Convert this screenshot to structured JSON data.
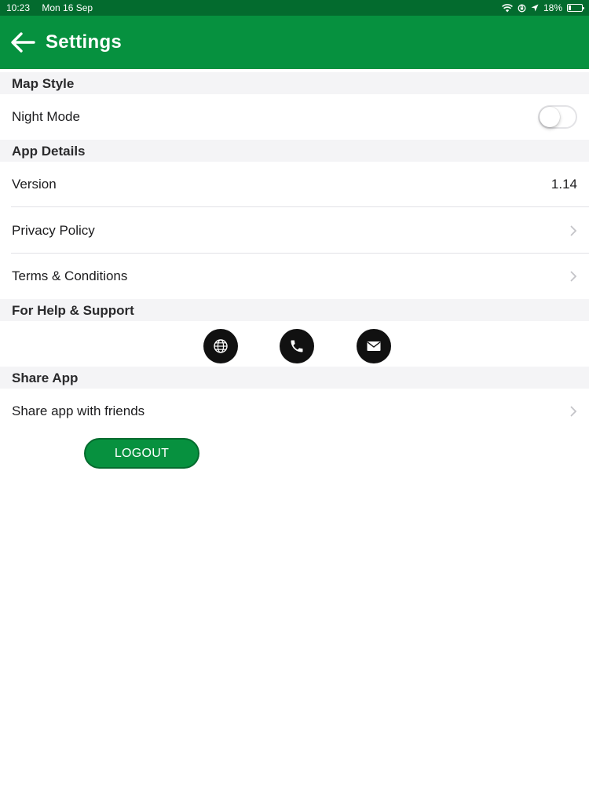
{
  "status_bar": {
    "time": "10:23",
    "date": "Mon 16 Sep",
    "battery": "18%",
    "battery_level": 0.18,
    "icons": [
      "wifi-icon",
      "rotation-lock-icon",
      "location-arrow-icon",
      "battery-icon"
    ]
  },
  "header": {
    "title": "Settings",
    "back_icon": "back-arrow-icon"
  },
  "sections": {
    "map_style": "Map Style",
    "app_details": "App Details",
    "help_support": "For Help & Support",
    "share_app": "Share App"
  },
  "rows": {
    "night_mode": {
      "label": "Night Mode",
      "enabled": false
    },
    "version": {
      "label": "Version",
      "value": "1.14"
    },
    "privacy_policy": {
      "label": "Privacy Policy"
    },
    "terms": {
      "label": "Terms & Conditions"
    },
    "share_friends": {
      "label": "Share app with friends"
    }
  },
  "support_icons": [
    "globe-icon",
    "phone-icon",
    "mail-icon"
  ],
  "logout": {
    "label": "LOGOUT"
  },
  "colors": {
    "status_bar": "#036b2e",
    "header": "#06913f",
    "section_bg": "#f4f4f6",
    "logout_button": "#07913f"
  }
}
